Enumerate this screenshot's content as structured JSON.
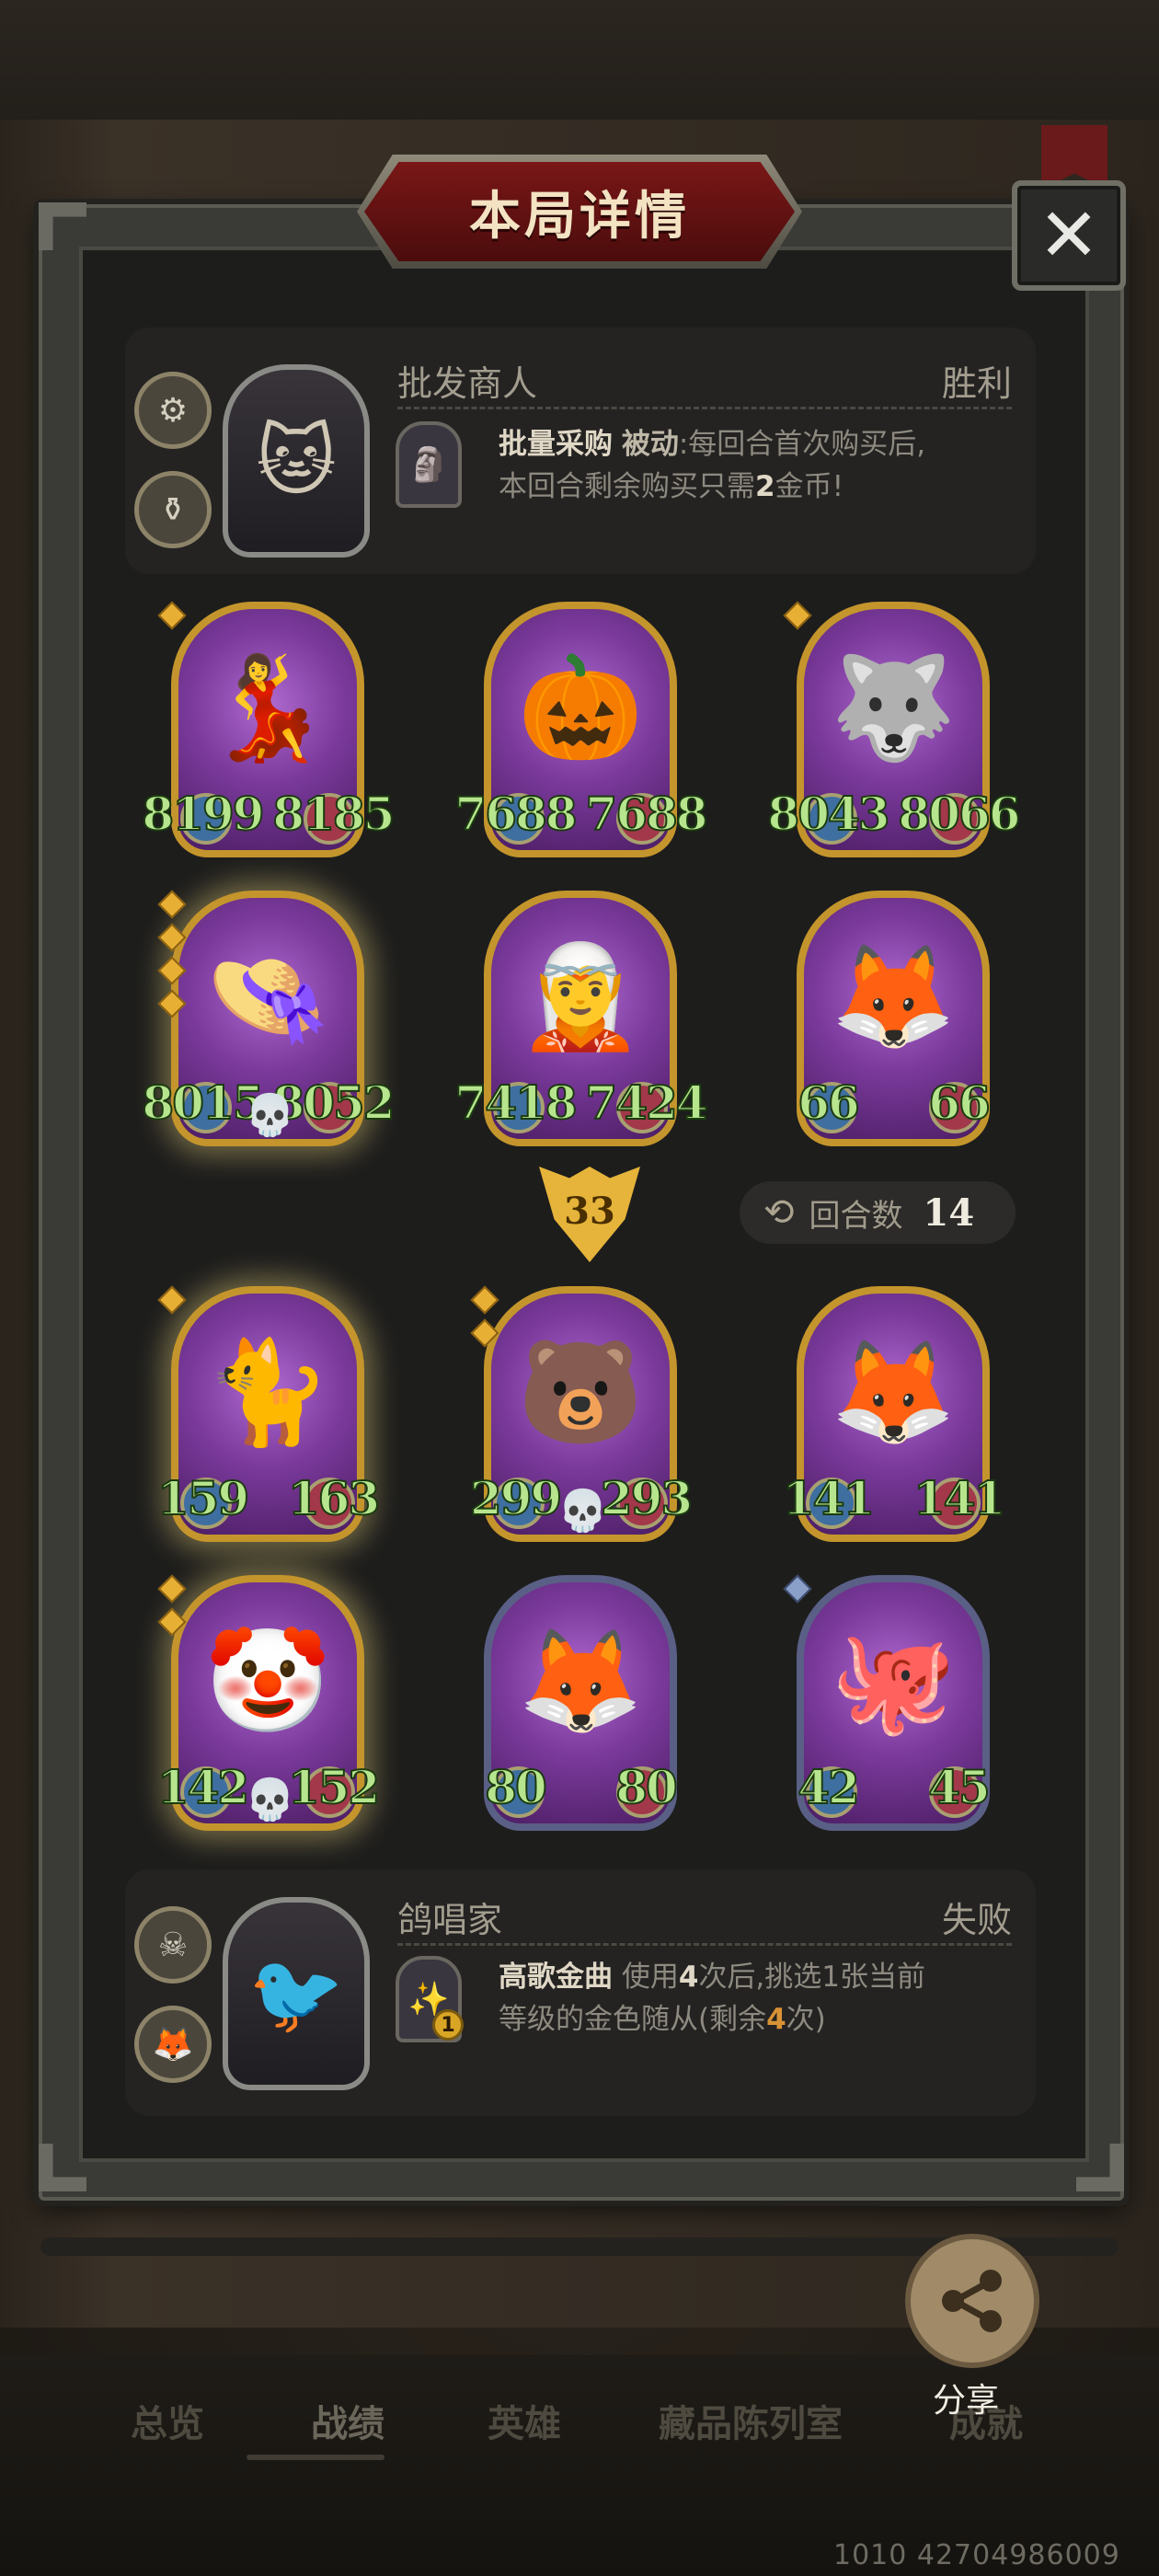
{
  "title": "本局详情",
  "close_icon": "close-icon",
  "top_hero": {
    "name": "批发商人",
    "result": "胜利",
    "skill_name": "批量采购",
    "skill_type": "被动",
    "skill_desc_1": ":每回合首次购买后,",
    "skill_desc_2a": "本回合剩余购买只需",
    "skill_desc_2_num": "2",
    "skill_desc_2b": "金币!"
  },
  "bottom_hero": {
    "name": "鸽唱家",
    "result": "失败",
    "skill_name": "高歌金曲",
    "skill_desc_1a": "使用",
    "skill_desc_1_num": "4",
    "skill_desc_1b": "次后,挑选1张当前",
    "skill_desc_2a": "等级的金色随从(剩余",
    "skill_desc_2_num": "4",
    "skill_desc_2b": "次)",
    "skill_badge": "1"
  },
  "top_board": [
    {
      "atk": "8199",
      "hp": "8185",
      "stars": 1,
      "icon": "pink-lady-icon"
    },
    {
      "atk": "7688",
      "hp": "7688",
      "stars": 0,
      "icon": "pumpkin-monster-icon"
    },
    {
      "atk": "8043",
      "hp": "8066",
      "stars": 1,
      "icon": "wolf-bandit-icon"
    },
    {
      "atk": "8015",
      "hp": "8052",
      "stars": 4,
      "icon": "scarecrow-lady-icon",
      "skull": true
    },
    {
      "atk": "7418",
      "hp": "7424",
      "stars": 0,
      "icon": "elf-sorceress-icon"
    },
    {
      "atk": "66",
      "hp": "66",
      "stars": 0,
      "icon": "fox-icon"
    }
  ],
  "vs_value": "33",
  "round": {
    "label": "回合数",
    "value": "14"
  },
  "bottom_board": [
    {
      "atk": "159",
      "hp": "163",
      "stars": 1,
      "icon": "pirate-cat-icon"
    },
    {
      "atk": "299",
      "hp": "293",
      "stars": 2,
      "icon": "bear-warrior-icon",
      "skull": true
    },
    {
      "atk": "141",
      "hp": "141",
      "stars": 0,
      "icon": "fox-icon"
    },
    {
      "atk": "142",
      "hp": "152",
      "stars": 2,
      "icon": "clown-icon",
      "skull": true
    },
    {
      "atk": "80",
      "hp": "80",
      "stars": 0,
      "icon": "fox-icon"
    },
    {
      "atk": "42",
      "hp": "45",
      "stars": 1,
      "icon": "octopus-pirate-icon"
    }
  ],
  "share_label": "分享",
  "tabs": [
    "总览",
    "战绩",
    "英雄",
    "藏品陈列室",
    "成就"
  ],
  "active_tab": "战绩",
  "footer_code": "1010 42704986009",
  "colors": {
    "stat_green": "#b7e58e",
    "gold_frame": "#c4952c",
    "banner_red": "#7a1717",
    "number_orange": "#d89236"
  }
}
